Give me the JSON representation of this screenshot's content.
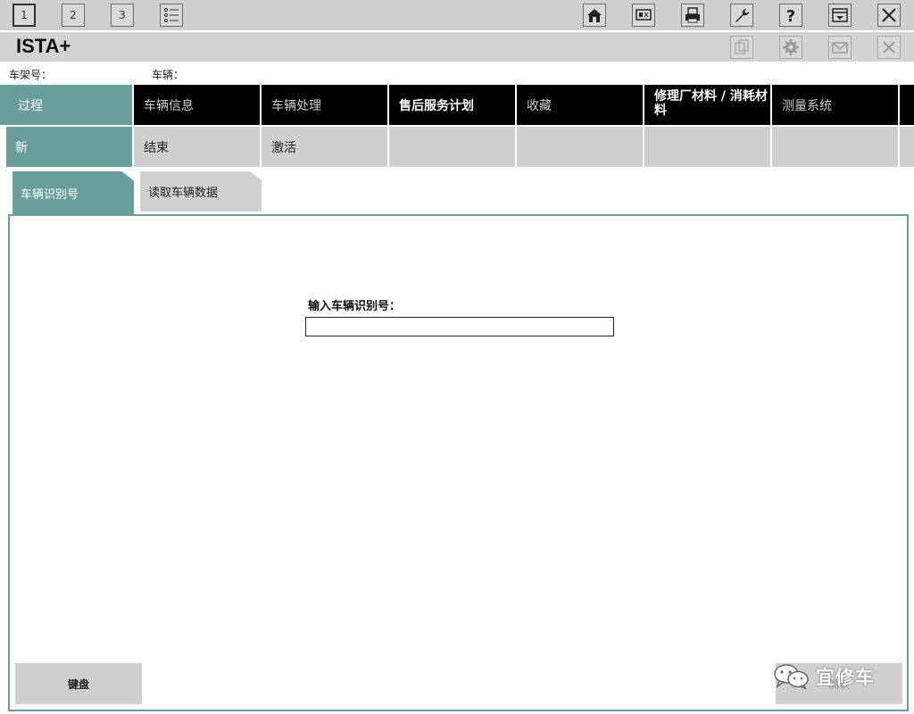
{
  "toolbar": {
    "left_buttons": [
      "1",
      "2",
      "3"
    ],
    "right_icons": [
      "home-icon",
      "display-icon",
      "print-icon",
      "wrench-icon",
      "help-icon",
      "window-icon",
      "close-icon"
    ]
  },
  "titlebar": {
    "title": "ISTA+",
    "icons": [
      "document-icon",
      "gear-icon",
      "mail-icon",
      "close-icon"
    ]
  },
  "info": {
    "vin_label": "车架号：",
    "vehicle_label": "车辆："
  },
  "main_nav": {
    "items": [
      "过程",
      "车辆信息",
      "车辆处理",
      "售后服务计划",
      "收藏",
      "修理厂材料 / 消耗材料",
      "测量系统"
    ]
  },
  "sub_nav": {
    "items": [
      "新",
      "结束",
      "激活",
      "",
      "",
      "",
      ""
    ]
  },
  "tabs": {
    "items": [
      "车辆识别号",
      "读取车辆数据"
    ]
  },
  "panel": {
    "vin_prompt": "输入车辆识别号：",
    "vin_value": "",
    "keyboard_label": "键盘",
    "ok_label": "确认"
  },
  "watermark": {
    "text": "宜修车"
  },
  "colors": {
    "accent": "#6a9e9c",
    "nav_bg": "#000000",
    "toolbar_bg": "#cfcfcf"
  }
}
